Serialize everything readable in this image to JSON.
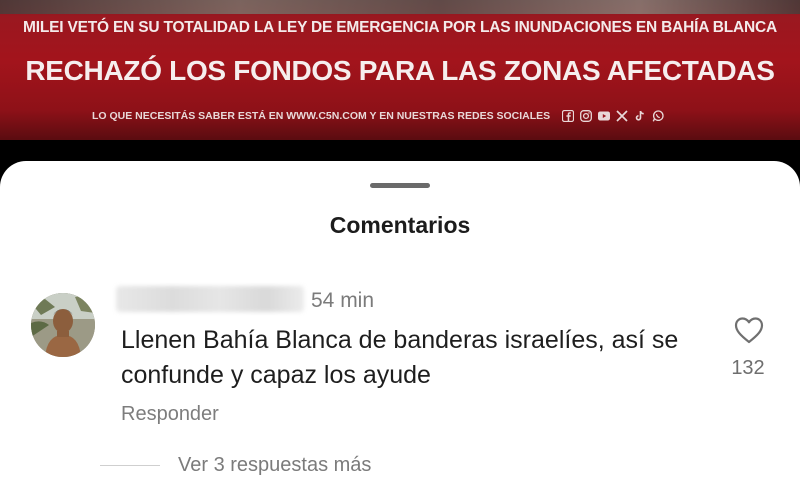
{
  "banner": {
    "headline_small": "MILEI VETÓ EN SU TOTALIDAD LA LEY DE EMERGENCIA POR LAS INUNDACIONES EN BAHÍA BLANCA",
    "headline_big": "RECHAZÓ LOS FONDOS PARA LAS ZONAS AFECTADAS",
    "footer_text": "LO QUE NECESITÁS SABER ESTÁ EN WWW.C5N.COM Y EN NUESTRAS REDES SOCIALES",
    "social_icons": [
      "facebook-icon",
      "instagram-icon",
      "youtube-icon",
      "x-icon",
      "tiktok-icon",
      "whatsapp-icon"
    ],
    "color": "#a3141c"
  },
  "sheet": {
    "title": "Comentarios"
  },
  "comment": {
    "time": "54 min",
    "text": "Llenen Bahía Blanca de banderas israelíes, así se confunde y capaz los ayude",
    "like_count": "132",
    "reply_label": "Responder",
    "view_replies_label": "Ver 3 respuestas más"
  }
}
